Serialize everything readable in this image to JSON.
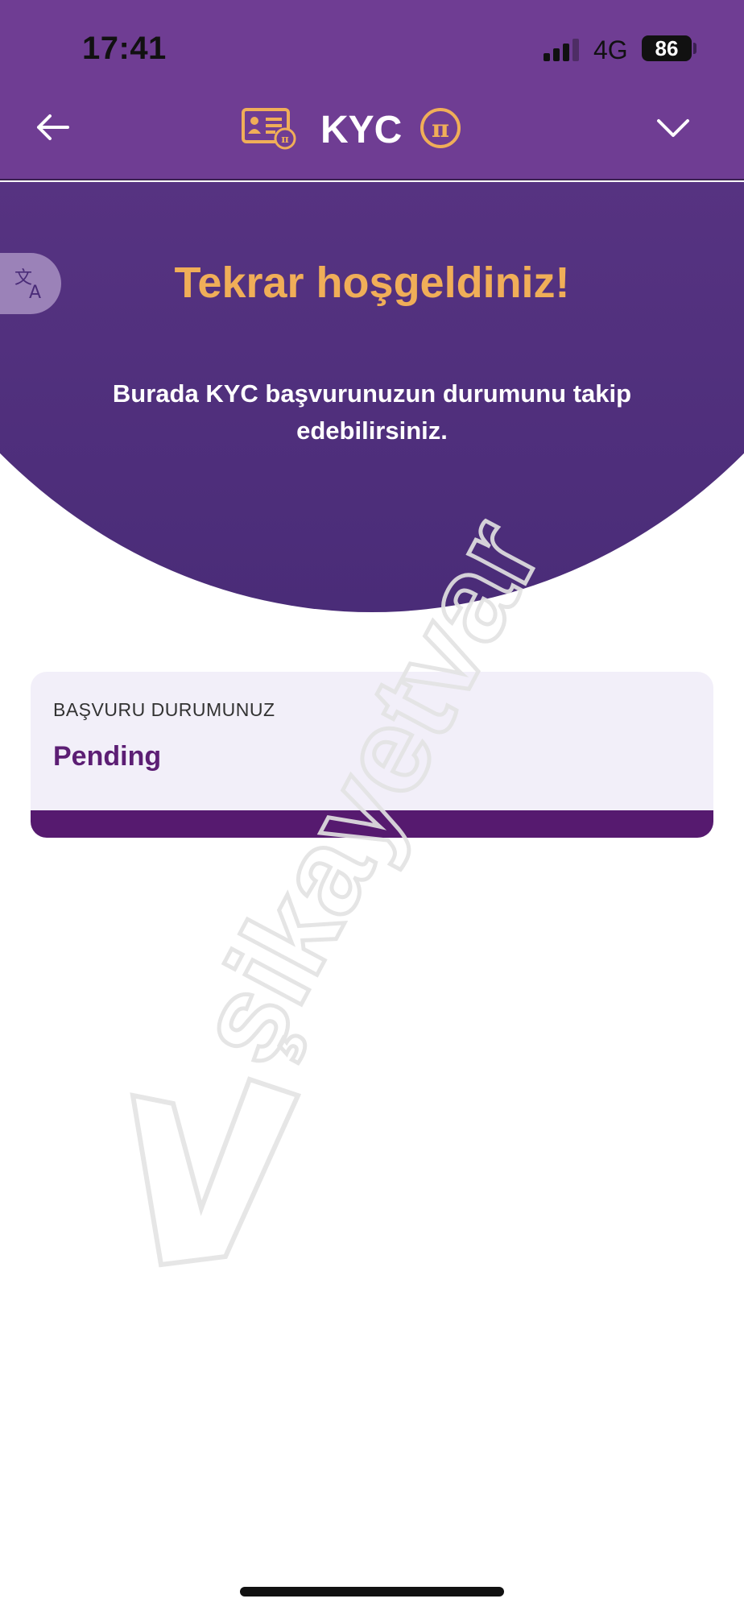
{
  "status_bar": {
    "time": "17:41",
    "network": "4G",
    "battery": "86"
  },
  "nav": {
    "title": "KYC",
    "back_icon": "arrow-left-icon",
    "card_icon": "id-card-icon",
    "pi_icon": "pi-coin-icon",
    "menu_icon": "chevron-down-icon"
  },
  "hero": {
    "title": "Tekrar hoşgeldiniz!",
    "subtitle": "Burada KYC başvurunuzun durumunu takip edebilirsiniz.",
    "translate_icon": "translate-icon"
  },
  "status_card": {
    "label": "BAŞVURU DURUMUNUZ",
    "value": "Pending"
  },
  "watermark": {
    "text": "şikayetvar"
  },
  "colors": {
    "header_purple": "#6f3d93",
    "accent_orange": "#f0ae58",
    "status_purple": "#5c1e74",
    "card_bg": "#f2eff9"
  }
}
